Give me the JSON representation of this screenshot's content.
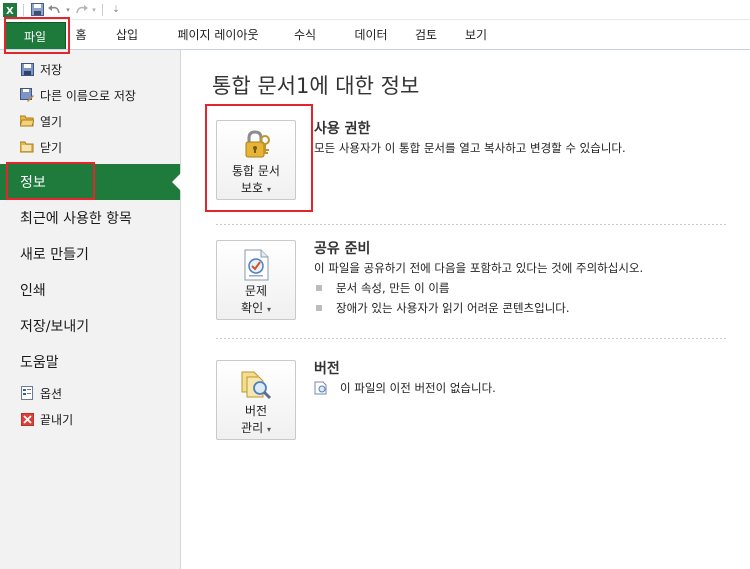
{
  "quick_access": {
    "icons": [
      "excel-icon",
      "save-icon",
      "undo-icon",
      "redo-icon",
      "customize-icon"
    ]
  },
  "ribbon": {
    "tabs": [
      {
        "label": "파일",
        "active": true
      },
      {
        "label": "홈"
      },
      {
        "label": "삽입"
      },
      {
        "label": "페이지 레이아웃"
      },
      {
        "label": "수식"
      },
      {
        "label": "데이터"
      },
      {
        "label": "검토"
      },
      {
        "label": "보기"
      }
    ]
  },
  "nav": {
    "small_top": [
      {
        "label": "저장",
        "icon": "save-icon"
      },
      {
        "label": "다른 이름으로 저장",
        "icon": "save-as-icon"
      },
      {
        "label": "열기",
        "icon": "open-folder-icon"
      },
      {
        "label": "닫기",
        "icon": "close-folder-icon"
      }
    ],
    "big": [
      {
        "label": "정보",
        "active": true
      },
      {
        "label": "최근에 사용한 항목"
      },
      {
        "label": "새로 만들기"
      },
      {
        "label": "인쇄"
      },
      {
        "label": "저장/보내기"
      },
      {
        "label": "도움말"
      }
    ],
    "small_bottom": [
      {
        "label": "옵션",
        "icon": "options-icon"
      },
      {
        "label": "끝내기",
        "icon": "exit-icon"
      }
    ]
  },
  "main": {
    "title": "통합 문서1에 대한 정보",
    "permissions": {
      "button_line1": "통합 문서",
      "button_line2": "보호",
      "title": "사용 권한",
      "desc": "모든 사용자가 이 통합 문서를 열고 복사하고 변경할 수 있습니다."
    },
    "prepare": {
      "button_line1": "문제",
      "button_line2": "확인",
      "title": "공유 준비",
      "desc": "이 파일을 공유하기 전에 다음을 포함하고 있다는 것에 주의하십시오.",
      "bullets": [
        "문서 속성, 만든 이 이름",
        "장애가 있는 사용자가 읽기 어려운 콘텐츠입니다."
      ]
    },
    "versions": {
      "button_line1": "버전",
      "button_line2": "관리",
      "title": "버전",
      "desc": "이 파일의 이전 버전이 없습니다."
    }
  },
  "colors": {
    "file_tab": "#1d7a3a",
    "nav_active": "#1e7b3b",
    "annotation": "#e3262d"
  }
}
